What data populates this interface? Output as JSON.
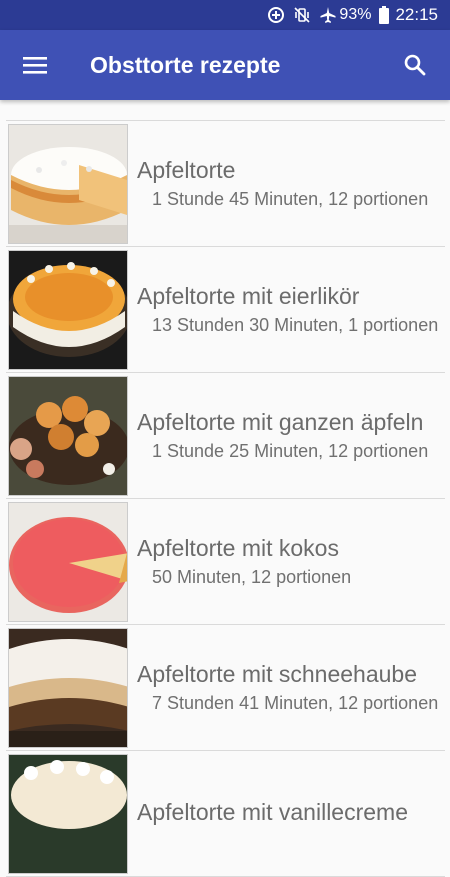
{
  "status": {
    "battery_percent": "93%",
    "time": "22:15",
    "icons": [
      "data-saver-icon",
      "vibrate-icon",
      "airplane-mode-icon",
      "battery-icon"
    ]
  },
  "app_bar": {
    "title": "Obsttorte rezepte",
    "menu_icon": "hamburger-menu-icon",
    "search_icon": "search-icon"
  },
  "recipes": [
    {
      "title": "Apfeltorte",
      "meta": "1 Stunde 45 Minuten, 12 portionen"
    },
    {
      "title": "Apfeltorte mit eierlikör",
      "meta": "13 Stunden 30 Minuten, 1 portionen"
    },
    {
      "title": "Apfeltorte mit ganzen äpfeln",
      "meta": "1 Stunde 25 Minuten, 12 portionen"
    },
    {
      "title": "Apfeltorte mit kokos",
      "meta": "50 Minuten, 12 portionen"
    },
    {
      "title": "Apfeltorte mit schneehaube",
      "meta": "7 Stunden 41 Minuten, 12 portionen"
    },
    {
      "title": "Apfeltorte mit vanillecreme",
      "meta": ""
    }
  ],
  "colors": {
    "status_bar": "#2c3b94",
    "app_bar": "#3f51b5",
    "text": "#6b6b6b"
  }
}
